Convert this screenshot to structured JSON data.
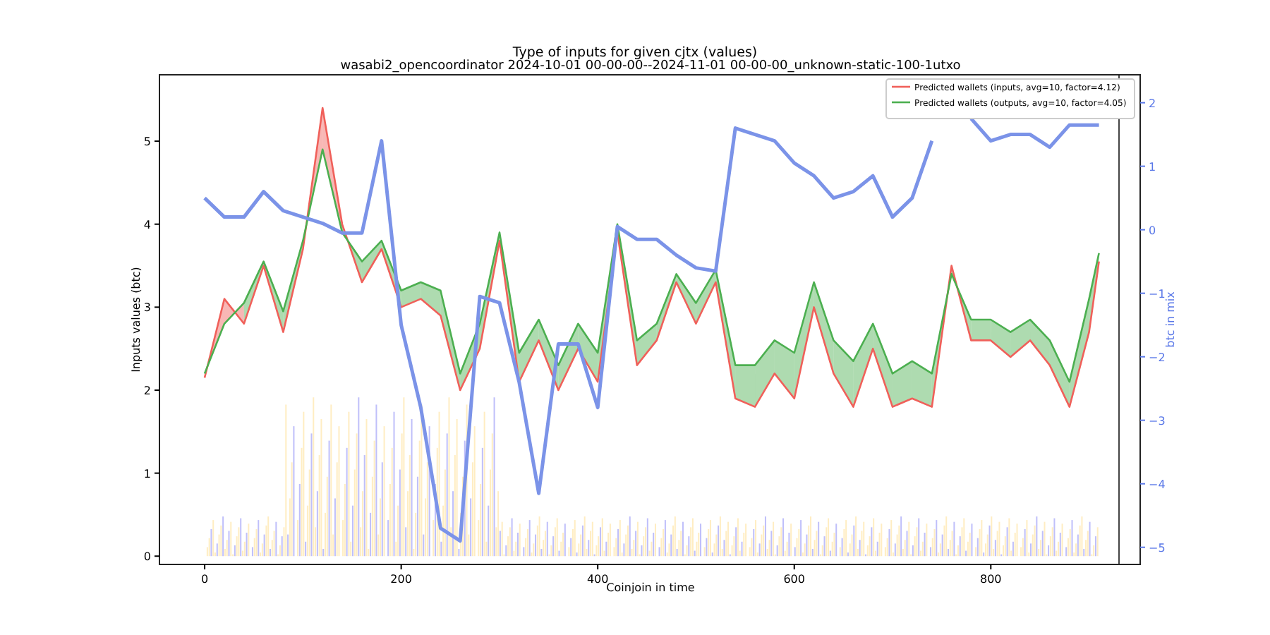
{
  "figure": {
    "title": "Type of inputs for given cjtx (values)",
    "subtitle": "wasabi2_opencoordinator 2024-10-01 00-00-00--2024-11-01 00-00-00_unknown-static-100-1utxo"
  },
  "chart_data": {
    "type": "line",
    "xlabel": "Coinjoin in time",
    "ylabel": "Inputs values (btc)",
    "y2label": "btc in mix",
    "legend": true,
    "xlim": [
      -46,
      952
    ],
    "ylim": [
      -0.1,
      5.8
    ],
    "y2lim": [
      -5.27,
      2.44
    ],
    "xticks": [
      0,
      200,
      400,
      600,
      800
    ],
    "yticks": [
      0,
      1,
      2,
      3,
      4,
      5
    ],
    "y2ticks": [
      -5,
      -4,
      -3,
      -2,
      -1,
      0,
      1,
      2
    ],
    "x": [
      0,
      20,
      40,
      60,
      80,
      100,
      120,
      140,
      160,
      180,
      200,
      220,
      240,
      260,
      280,
      300,
      320,
      340,
      360,
      380,
      400,
      420,
      440,
      460,
      480,
      500,
      520,
      540,
      560,
      580,
      600,
      620,
      640,
      660,
      680,
      700,
      720,
      740,
      760,
      780,
      800,
      820,
      840,
      860,
      880,
      900,
      910
    ],
    "series": [
      {
        "name": "Predicted wallets (inputs, avg=10, factor=4.12)",
        "color": "#f0605a",
        "values": [
          2.15,
          3.1,
          2.8,
          3.5,
          2.7,
          3.7,
          5.4,
          4.0,
          3.3,
          3.7,
          3.0,
          3.1,
          2.9,
          2.0,
          2.5,
          3.8,
          2.1,
          2.6,
          2.0,
          2.5,
          2.1,
          3.9,
          2.3,
          2.6,
          3.3,
          2.8,
          3.3,
          1.9,
          1.8,
          2.2,
          1.9,
          3.0,
          2.2,
          1.8,
          2.5,
          1.8,
          1.9,
          1.8,
          3.5,
          2.6,
          2.6,
          2.4,
          2.6,
          2.3,
          1.8,
          2.7,
          3.55
        ]
      },
      {
        "name": "Predicted wallets (outputs, avg=10, factor=4.05)",
        "color": "#4caf50",
        "values": [
          2.2,
          2.8,
          3.05,
          3.55,
          2.95,
          3.8,
          4.9,
          3.9,
          3.55,
          3.8,
          3.2,
          3.3,
          3.2,
          2.2,
          2.8,
          3.9,
          2.45,
          2.85,
          2.3,
          2.8,
          2.45,
          4.0,
          2.6,
          2.8,
          3.4,
          3.05,
          3.45,
          2.3,
          2.3,
          2.6,
          2.45,
          3.3,
          2.6,
          2.35,
          2.8,
          2.2,
          2.35,
          2.2,
          3.4,
          2.85,
          2.85,
          2.7,
          2.85,
          2.6,
          2.1,
          3.1,
          3.65
        ]
      },
      {
        "color": "#7b93e8",
        "axis": "y2",
        "values": [
          0.5,
          0.2,
          0.2,
          0.6,
          0.3,
          0.2,
          0.1,
          -0.05,
          -0.05,
          1.4,
          -1.5,
          -2.8,
          -4.7,
          -4.9,
          -1.05,
          -1.15,
          -2.4,
          -4.15,
          -1.8,
          -1.8,
          -2.8,
          0.05,
          -0.15,
          -0.15,
          -0.4,
          -0.6,
          -0.65,
          1.6,
          1.5,
          1.4,
          1.05,
          0.85,
          0.5,
          0.6,
          0.85,
          0.2,
          0.5,
          1.4,
          null,
          1.75,
          1.4,
          1.5,
          1.5,
          1.3,
          1.65,
          1.65,
          1.65
        ]
      }
    ]
  }
}
